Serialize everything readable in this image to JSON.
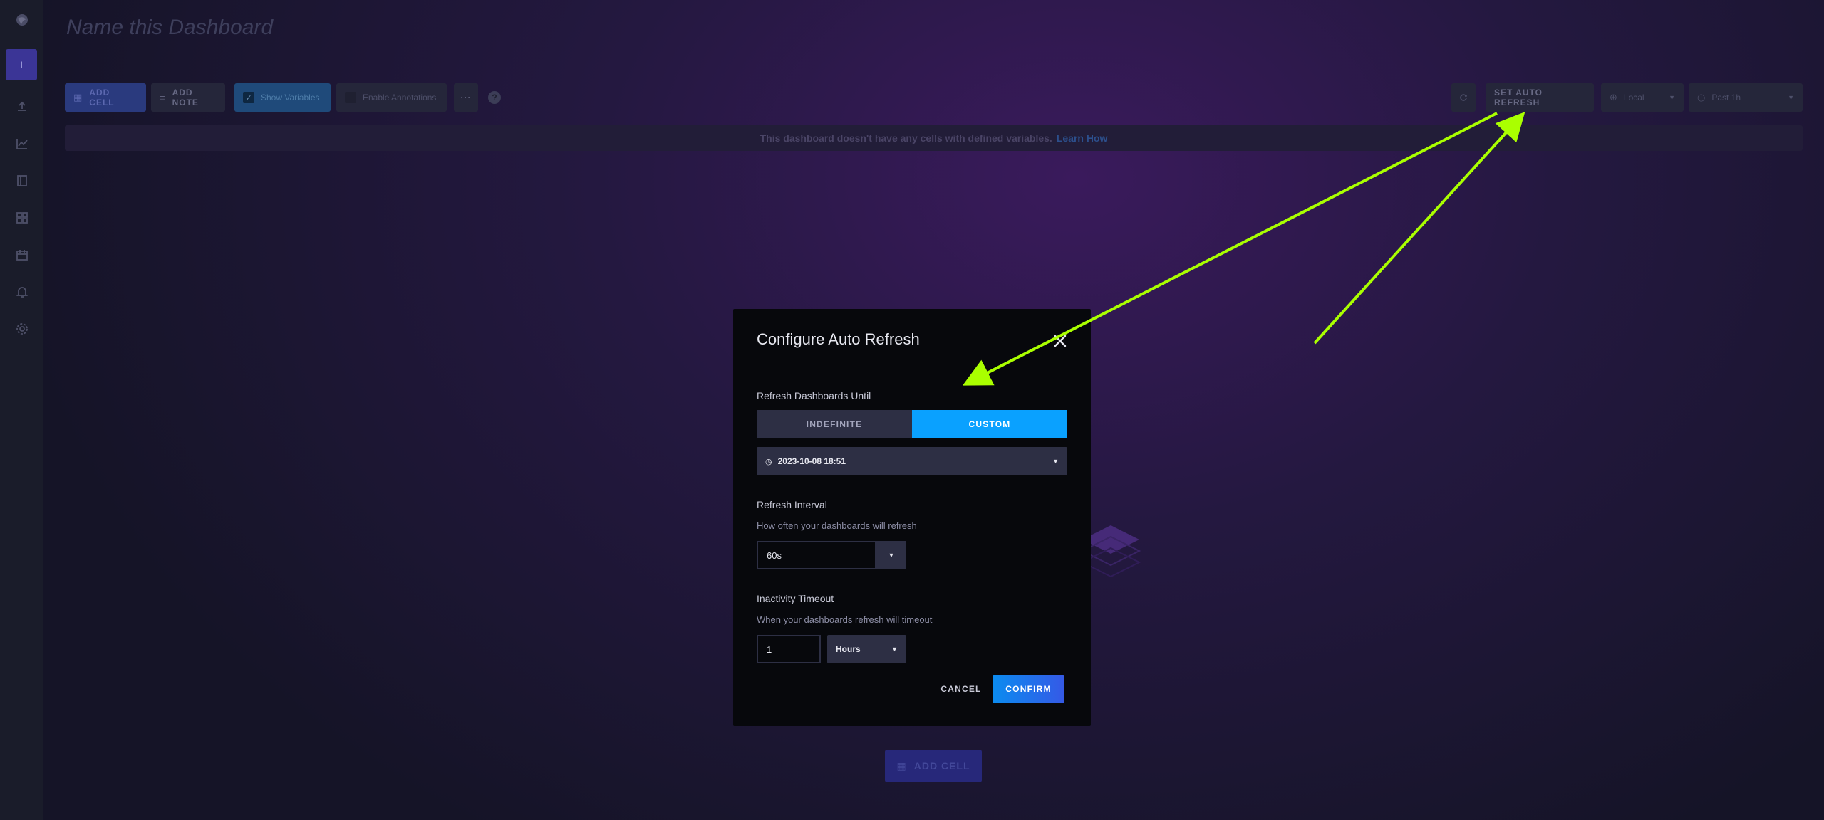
{
  "dashboard": {
    "title_placeholder": "Name this Dashboard",
    "nav_active_label": "I"
  },
  "toolbar": {
    "add_cell": "ADD CELL",
    "add_note": "ADD NOTE",
    "show_variables": "Show Variables",
    "enable_annotations": "Enable Annotations",
    "more": "···",
    "help": "?",
    "set_auto_refresh": "SET AUTO REFRESH",
    "timezone": "Local",
    "time_range": "Past 1h"
  },
  "banner": {
    "message": "This dashboard doesn't have any cells with defined variables.",
    "link": "Learn How"
  },
  "empty_state": {
    "add_cell": "ADD CELL"
  },
  "modal": {
    "title": "Configure Auto Refresh",
    "refresh_until_label": "Refresh Dashboards Until",
    "options": [
      "INDEFINITE",
      "CUSTOM"
    ],
    "selected_option": "CUSTOM",
    "until_datetime": "2023-10-08 18:51",
    "interval_label": "Refresh Interval",
    "interval_help": "How often your dashboards will refresh",
    "interval_value": "60s",
    "timeout_label": "Inactivity Timeout",
    "timeout_help": "When your dashboards refresh will timeout",
    "timeout_value": "1",
    "timeout_unit": "Hours",
    "cancel": "CANCEL",
    "confirm": "CONFIRM"
  },
  "colors": {
    "accent": "#0aa1ff",
    "annotation_arrow": "#aaff00",
    "modal_bg": "#07080c"
  }
}
